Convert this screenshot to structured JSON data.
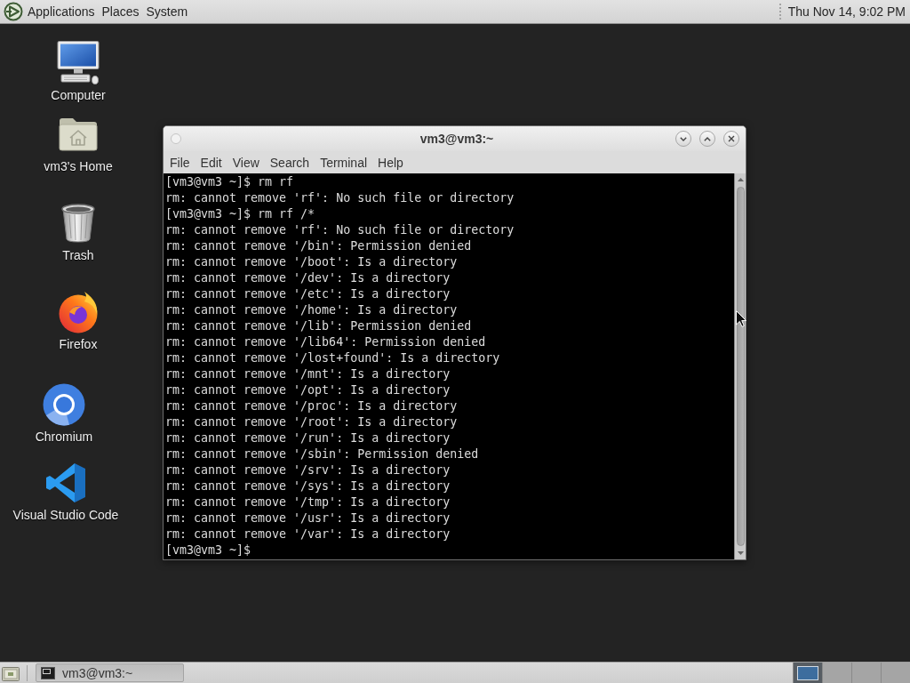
{
  "top_panel": {
    "menus": [
      "Applications",
      "Places",
      "System"
    ],
    "clock": "Thu Nov 14, 9:02 PM"
  },
  "desktop_icons": [
    {
      "kind": "computer",
      "label": "Computer"
    },
    {
      "kind": "home",
      "label": "vm3's Home"
    },
    {
      "kind": "trash",
      "label": "Trash"
    },
    {
      "kind": "firefox",
      "label": "Firefox"
    },
    {
      "kind": "chromium",
      "label": "Chromium"
    },
    {
      "kind": "vscode",
      "label": "Visual Studio Code"
    }
  ],
  "terminal_window": {
    "title": "vm3@vm3:~",
    "menu": [
      "File",
      "Edit",
      "View",
      "Search",
      "Terminal",
      "Help"
    ],
    "lines": [
      "[vm3@vm3 ~]$ rm rf",
      "rm: cannot remove 'rf': No such file or directory",
      "[vm3@vm3 ~]$ rm rf /*",
      "rm: cannot remove 'rf': No such file or directory",
      "rm: cannot remove '/bin': Permission denied",
      "rm: cannot remove '/boot': Is a directory",
      "rm: cannot remove '/dev': Is a directory",
      "rm: cannot remove '/etc': Is a directory",
      "rm: cannot remove '/home': Is a directory",
      "rm: cannot remove '/lib': Permission denied",
      "rm: cannot remove '/lib64': Permission denied",
      "rm: cannot remove '/lost+found': Is a directory",
      "rm: cannot remove '/mnt': Is a directory",
      "rm: cannot remove '/opt': Is a directory",
      "rm: cannot remove '/proc': Is a directory",
      "rm: cannot remove '/root': Is a directory",
      "rm: cannot remove '/run': Is a directory",
      "rm: cannot remove '/sbin': Permission denied",
      "rm: cannot remove '/srv': Is a directory",
      "rm: cannot remove '/sys': Is a directory",
      "rm: cannot remove '/tmp': Is a directory",
      "rm: cannot remove '/usr': Is a directory",
      "rm: cannot remove '/var': Is a directory",
      "[vm3@vm3 ~]$"
    ]
  },
  "bottom_panel": {
    "tasks": [
      {
        "label": "vm3@vm3:~",
        "selected": true
      }
    ],
    "workspaces": [
      {
        "selected": true
      },
      {
        "selected": false
      },
      {
        "selected": false
      },
      {
        "selected": false
      }
    ]
  }
}
